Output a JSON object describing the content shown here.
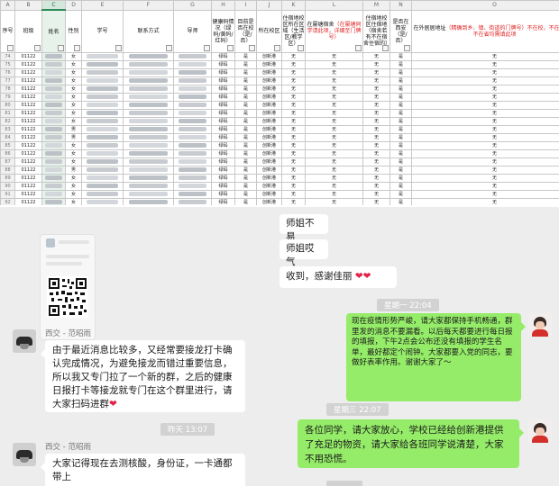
{
  "sheet": {
    "col_letters": [
      "A",
      "B",
      "C",
      "D",
      "E",
      "F",
      "G",
      "H",
      "I",
      "J",
      "K",
      "L",
      "M",
      "N",
      "O"
    ],
    "headers": {
      "seq": "序号",
      "class": "班级",
      "name": "姓名",
      "gender": "性别",
      "student_id": "学号",
      "contact": "联系方式",
      "tutor": "导师",
      "health_code": "健康码情况（绿码/黄码/红码）",
      "on_campus": "目前是否在校（是/否）",
      "campus": "所在校区",
      "dorm_area": "住宿地校区所在区域（生活区/教学区）",
      "dorm_addr_main": "在屡塘宿舍",
      "dorm_addr_red": "（在屡塘同学请此项，详细至门牌号）",
      "dorm_other_main": "住宿地校区住宿地（宿舍若有不在宿舍住宿的）",
      "in_xi_an": "是否在西安（是/否）",
      "offcampus_main": "在外居居地址",
      "offcampus_red": "（精确到乡、镇、街道的门牌号）不在校，不在西安，不在省均需填此项"
    },
    "rows": [
      {
        "n": "74",
        "cls": "01122",
        "g": "女",
        "hc": "绿码",
        "oc": "是",
        "cp": "创新港",
        "a": "无",
        "b": "无",
        "c": "无",
        "d": "是",
        "e": "无"
      },
      {
        "n": "75",
        "cls": "01122",
        "g": "女",
        "hc": "绿码",
        "oc": "是",
        "cp": "创新港",
        "a": "无",
        "b": "无",
        "c": "无",
        "d": "是",
        "e": "无"
      },
      {
        "n": "76",
        "cls": "01122",
        "g": "女",
        "hc": "绿码",
        "oc": "是",
        "cp": "创新港",
        "a": "无",
        "b": "无",
        "c": "无",
        "d": "是",
        "e": "无"
      },
      {
        "n": "77",
        "cls": "01122",
        "g": "女",
        "hc": "绿码",
        "oc": "是",
        "cp": "创新港",
        "a": "无",
        "b": "无",
        "c": "无",
        "d": "是",
        "e": "无"
      },
      {
        "n": "78",
        "cls": "01122",
        "g": "女",
        "hc": "绿码",
        "oc": "是",
        "cp": "创新港",
        "a": "无",
        "b": "无",
        "c": "无",
        "d": "是",
        "e": "无"
      },
      {
        "n": "79",
        "cls": "01122",
        "g": "女",
        "hc": "绿码",
        "oc": "是",
        "cp": "创新港",
        "a": "无",
        "b": "无",
        "c": "无",
        "d": "是",
        "e": "无"
      },
      {
        "n": "80",
        "cls": "01122",
        "g": "女",
        "hc": "绿码",
        "oc": "是",
        "cp": "创新港",
        "a": "无",
        "b": "无",
        "c": "无",
        "d": "是",
        "e": "无"
      },
      {
        "n": "81",
        "cls": "01122",
        "g": "女",
        "hc": "绿码",
        "oc": "是",
        "cp": "创新港",
        "a": "无",
        "b": "无",
        "c": "无",
        "d": "是",
        "e": "无"
      },
      {
        "n": "82",
        "cls": "01122",
        "g": "女",
        "hc": "绿码",
        "oc": "是",
        "cp": "创新港",
        "a": "无",
        "b": "无",
        "c": "无",
        "d": "是",
        "e": "无"
      },
      {
        "n": "83",
        "cls": "01122",
        "g": "男",
        "hc": "绿码",
        "oc": "是",
        "cp": "创新港",
        "a": "无",
        "b": "无",
        "c": "无",
        "d": "是",
        "e": "无"
      },
      {
        "n": "84",
        "cls": "01122",
        "g": "男",
        "hc": "绿码",
        "oc": "是",
        "cp": "创新港",
        "a": "无",
        "b": "无",
        "c": "无",
        "d": "是",
        "e": "无"
      },
      {
        "n": "85",
        "cls": "01122",
        "g": "女",
        "hc": "绿码",
        "oc": "是",
        "cp": "创新港",
        "a": "无",
        "b": "无",
        "c": "无",
        "d": "是",
        "e": "无"
      },
      {
        "n": "86",
        "cls": "01122",
        "g": "女",
        "hc": "绿码",
        "oc": "是",
        "cp": "创新港",
        "a": "无",
        "b": "无",
        "c": "无",
        "d": "是",
        "e": "无"
      },
      {
        "n": "87",
        "cls": "01122",
        "g": "女",
        "hc": "绿码",
        "oc": "是",
        "cp": "创新港",
        "a": "无",
        "b": "无",
        "c": "无",
        "d": "是",
        "e": "无"
      },
      {
        "n": "88",
        "cls": "01122",
        "g": "男",
        "hc": "绿码",
        "oc": "是",
        "cp": "创新港",
        "a": "无",
        "b": "无",
        "c": "无",
        "d": "是",
        "e": "无"
      },
      {
        "n": "89",
        "cls": "01122",
        "g": "女",
        "hc": "绿码",
        "oc": "是",
        "cp": "创新港",
        "a": "无",
        "b": "无",
        "c": "无",
        "d": "是",
        "e": "无"
      },
      {
        "n": "90",
        "cls": "01122",
        "g": "女",
        "hc": "绿码",
        "oc": "是",
        "cp": "创新港",
        "a": "无",
        "b": "无",
        "c": "无",
        "d": "是",
        "e": "无"
      },
      {
        "n": "91",
        "cls": "01122",
        "g": "女",
        "hc": "绿码",
        "oc": "是",
        "cp": "创新港",
        "a": "无",
        "b": "无",
        "c": "无",
        "d": "是",
        "e": "无"
      },
      {
        "n": "92",
        "cls": "01122",
        "g": "女",
        "hc": "绿码",
        "oc": "是",
        "cp": "创新港",
        "a": "无",
        "b": "无",
        "c": "无",
        "d": "是",
        "e": "无"
      }
    ]
  },
  "chat": {
    "msg_xuejie_buyi": "师姐不易",
    "msg_xuejie_kuqi": "师姐哎气",
    "msg_thanks": "收到，感谢佳丽",
    "time_1": "星期一 22:04",
    "sender_1": "西交 - 范昭雨",
    "msg_announce": "由于最近消息比较多，又经常要接龙打卡确认完成情况，为避免接龙而错过重要信息，所以我又专门拉了一个新的群，之后的健康日报打卡等接龙就专门在这个群里进行，请大家扫码进群",
    "msg_strict": "现在疫情形势严峻，请大家都保持手机畅通，群里发的消息不要漏看。以后每天都要进行每日报的填报，下午2点会公布还没有填报的学生名单，最好都定个闹钟。大家都要入党的同志，要做好表率作用。谢谢大家了～",
    "time_2": "星期三 22:07",
    "msg_reassure": "各位同学，请大家放心，学校已经给创新港提供了充足的物资，请大家给各班同学说清楚，大家不用恐慌。",
    "time_3": "昨天 13:07",
    "sender_2": "西交 - 范昭雨",
    "msg_bring": "大家记得现在去测核酸，身份证，一卡通都带上"
  }
}
